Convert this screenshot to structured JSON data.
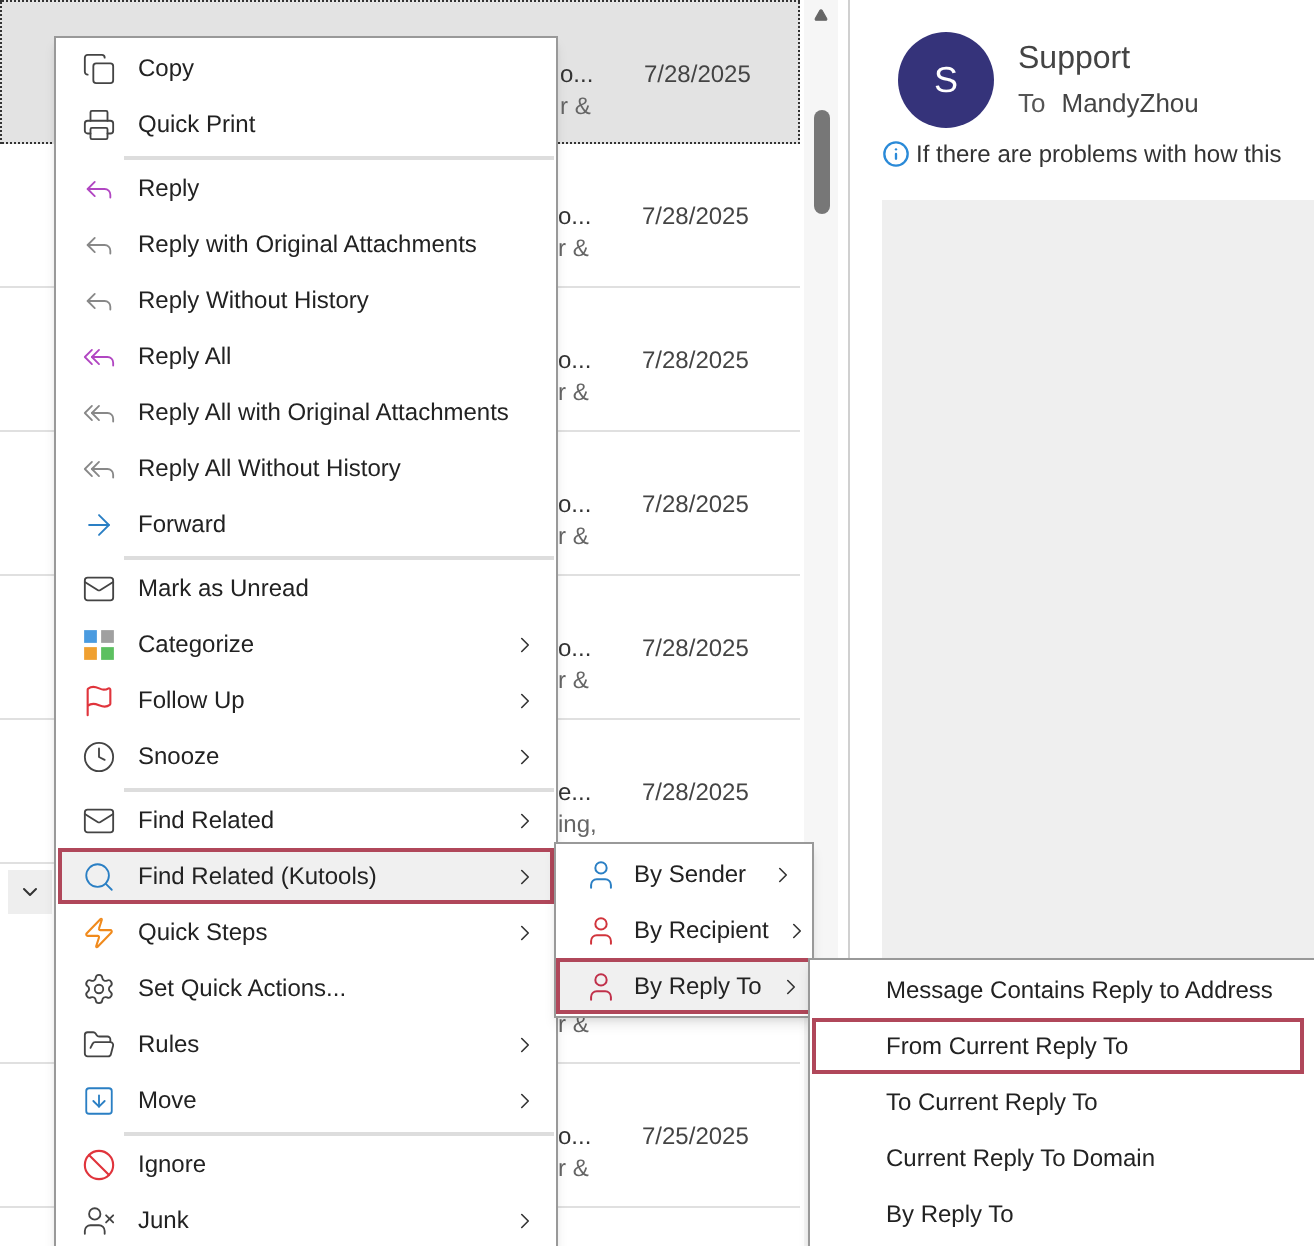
{
  "message_list": {
    "rows": [
      {
        "subject": "o...",
        "preview": "r &",
        "date": "7/28/2025",
        "selected": true
      },
      {
        "subject": "o...",
        "preview": "r &",
        "date": "7/28/2025",
        "selected": false
      },
      {
        "subject": "o...",
        "preview": "r &",
        "date": "7/28/2025",
        "selected": false
      },
      {
        "subject": "o...",
        "preview": "r &",
        "date": "7/28/2025",
        "selected": false
      },
      {
        "subject": "o...",
        "preview": "r &",
        "date": "7/28/2025",
        "selected": false
      },
      {
        "subject": "e...",
        "preview": "ing,",
        "date": "7/28/2025",
        "selected": false
      },
      {
        "kind": "group_header"
      },
      {
        "preview": "r &",
        "selected": false
      },
      {
        "subject": "o...",
        "preview": "r &",
        "date": "7/25/2025",
        "selected": false
      }
    ]
  },
  "reading_pane": {
    "avatar_letter": "S",
    "sender": "Support",
    "to_label": "To",
    "recipient": "MandyZhou",
    "info": "If there are problems with how this"
  },
  "context_menu": {
    "groups": [
      {
        "items": [
          {
            "label": "Copy",
            "has_submenu": false,
            "selected": false
          },
          {
            "label": "Quick Print",
            "has_submenu": false,
            "selected": false
          }
        ]
      },
      {
        "items": [
          {
            "label": "Reply",
            "has_submenu": false,
            "selected": false
          },
          {
            "label": "Reply with Original Attachments",
            "has_submenu": false,
            "selected": false
          },
          {
            "label": "Reply Without History",
            "has_submenu": false,
            "selected": false
          },
          {
            "label": "Reply All",
            "has_submenu": false,
            "selected": false
          },
          {
            "label": "Reply All with Original Attachments",
            "has_submenu": false,
            "selected": false
          },
          {
            "label": "Reply All Without History",
            "has_submenu": false,
            "selected": false
          },
          {
            "label": "Forward",
            "has_submenu": false,
            "selected": false
          }
        ]
      },
      {
        "items": [
          {
            "label": "Mark as Unread",
            "has_submenu": false,
            "selected": false
          },
          {
            "label": "Categorize",
            "has_submenu": true,
            "selected": false
          },
          {
            "label": "Follow Up",
            "has_submenu": true,
            "selected": false
          },
          {
            "label": "Snooze",
            "has_submenu": true,
            "selected": false
          }
        ]
      },
      {
        "items": [
          {
            "label": "Find Related",
            "has_submenu": true,
            "selected": false
          },
          {
            "label": "Find Related (Kutools)",
            "has_submenu": true,
            "selected": true
          },
          {
            "label": "Quick Steps",
            "has_submenu": true,
            "selected": false
          },
          {
            "label": "Set Quick Actions...",
            "has_submenu": false,
            "selected": false
          },
          {
            "label": "Rules",
            "has_submenu": true,
            "selected": false
          },
          {
            "label": "Move",
            "has_submenu": true,
            "selected": false
          }
        ]
      },
      {
        "items": [
          {
            "label": "Ignore",
            "has_submenu": false,
            "selected": false
          },
          {
            "label": "Junk",
            "has_submenu": true,
            "selected": false
          }
        ]
      }
    ]
  },
  "kutools_submenu": {
    "items": [
      {
        "label": "By Sender",
        "has_submenu": true,
        "selected": false
      },
      {
        "label": "By Recipient",
        "has_submenu": true,
        "selected": false
      },
      {
        "label": "By Reply To",
        "has_submenu": true,
        "selected": true
      }
    ]
  },
  "reply_to_submenu": {
    "items": [
      {
        "label": "Message Contains Reply to Address",
        "selected": false
      },
      {
        "label": "From Current Reply To",
        "selected": true
      },
      {
        "label": "To Current Reply To",
        "selected": false
      },
      {
        "label": "Current Reply To Domain",
        "selected": false
      },
      {
        "label": "By Reply To",
        "selected": false
      }
    ]
  }
}
